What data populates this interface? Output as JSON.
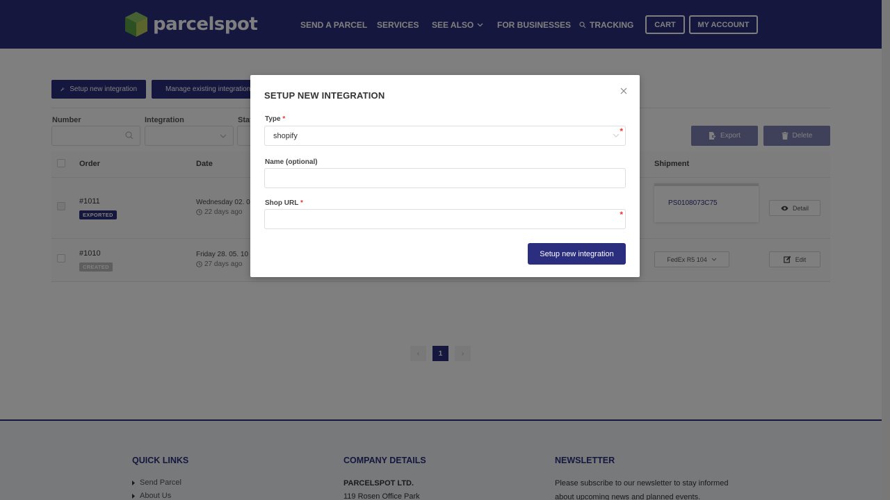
{
  "header": {
    "brand": "parcelspot",
    "nav": [
      {
        "label": "SEND A PARCEL"
      },
      {
        "label": "SERVICES"
      },
      {
        "label": "SEE ALSO",
        "icon": "chevron-down-icon"
      },
      {
        "label": "FOR BUSINESSES"
      },
      {
        "label": "TRACKING",
        "icon": "search-icon"
      }
    ],
    "cart_label": "CART",
    "account_label": "MY ACCOUNT"
  },
  "toolbar": {
    "setup_label": "Setup new integration",
    "manage_label": "Manage existing integrations"
  },
  "filters": {
    "number_label": "Number",
    "number_value": "",
    "integration_label": "Integration",
    "integration_value": "",
    "status_label": "Status",
    "status_value": ""
  },
  "actions": {
    "export_label": "Export",
    "delete_label": "Delete"
  },
  "table": {
    "columns": [
      "Order",
      "Date",
      "Shipment"
    ],
    "rows": [
      {
        "order": "#1011",
        "status": "EXPORTED",
        "date": "Wednesday 02. 0",
        "relative": "22 days ago",
        "shipment": "PS0108073C75",
        "action": "Detail"
      },
      {
        "order": "#1010",
        "status": "CREATED",
        "date": "Friday 28. 05. 10",
        "relative": "27 days ago",
        "shipment": "FedEx R5 104",
        "action": "Edit"
      }
    ]
  },
  "pagination": {
    "prev": "‹",
    "current": "1",
    "next": "›"
  },
  "footer": {
    "quick_links_title": "QUICK LINKS",
    "quick_links": [
      "Send Parcel",
      "About Us"
    ],
    "company_title": "COMPANY DETAILS",
    "company_name": "PARCELSPOT LTD.",
    "company_address": "119 Rosen Office Park",
    "newsletter_title": "NEWSLETTER",
    "newsletter_text_1": "Please subscribe to our newsletter to stay informed",
    "newsletter_text_2": "about upcoming news and planned events."
  },
  "modal": {
    "title": "SETUP NEW INTEGRATION",
    "type_label": "Type",
    "type_value": "shopify",
    "name_label": "Name (optional)",
    "name_value": "",
    "url_label": "Shop URL",
    "url_value": "",
    "required_mark": "*",
    "submit_label": "Setup new integration"
  },
  "colors": {
    "brand": "#2b2e7e",
    "required": "#ee3333",
    "logo_green": "#6aa54a"
  }
}
